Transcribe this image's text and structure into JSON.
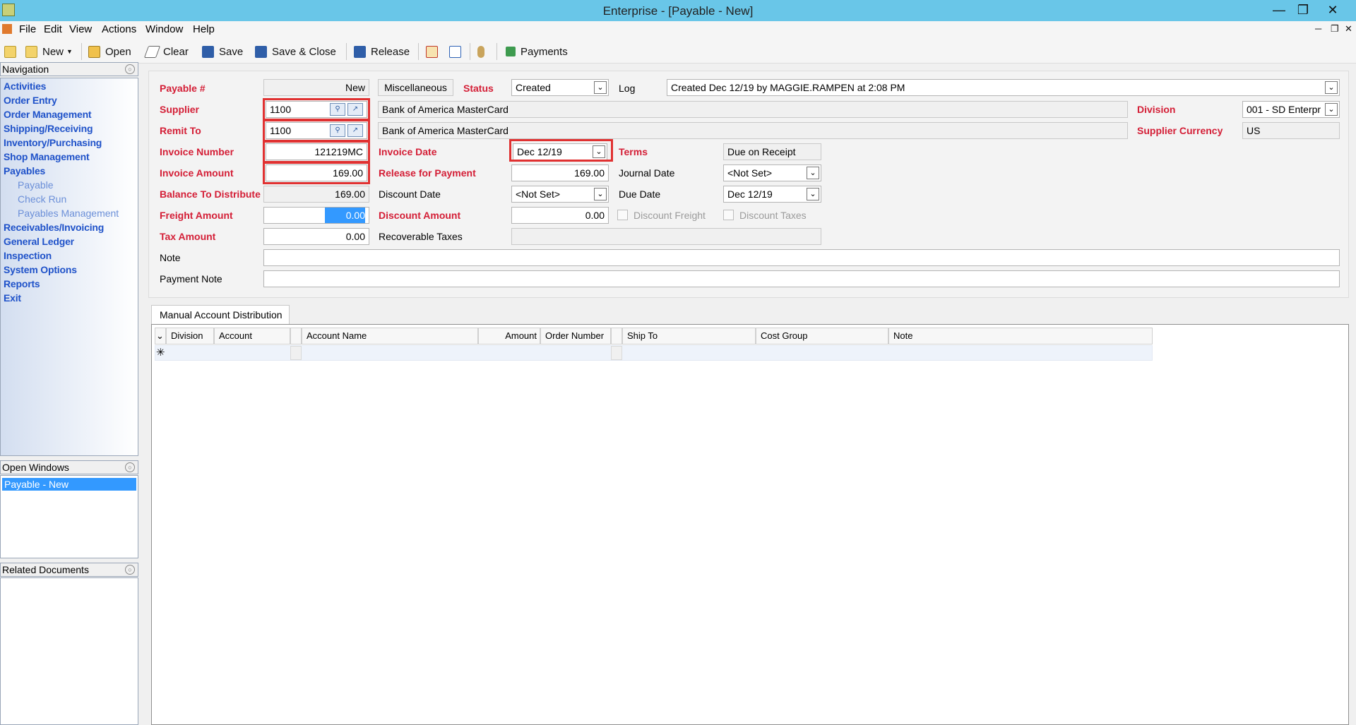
{
  "window": {
    "title": "Enterprise - [Payable - New]"
  },
  "menu": [
    "File",
    "Edit",
    "View",
    "Actions",
    "Window",
    "Help"
  ],
  "toolbar": {
    "new_label": "New",
    "open_label": "Open",
    "clear_label": "Clear",
    "save_label": "Save",
    "save_close_label": "Save & Close",
    "release_label": "Release",
    "payments_label": "Payments"
  },
  "navigation": {
    "header": "Navigation",
    "items": [
      "Activities",
      "Order Entry",
      "Order Management",
      "Shipping/Receiving",
      "Inventory/Purchasing",
      "Shop Management",
      "Payables"
    ],
    "sub_items": [
      "Payable",
      "Check Run",
      "Payables Management"
    ],
    "items_after": [
      "Receivables/Invoicing",
      "General Ledger",
      "Inspection",
      "System Options",
      "Reports",
      "Exit"
    ]
  },
  "open_windows": {
    "header": "Open Windows",
    "items": [
      "Payable - New"
    ]
  },
  "related_documents": {
    "header": "Related Documents"
  },
  "form": {
    "payable_no_label": "Payable #",
    "payable_no_value": "New",
    "misc_button": "Miscellaneous",
    "status_label": "Status",
    "status_value": "Created",
    "log_label": "Log",
    "log_value": "Created Dec 12/19 by MAGGIE.RAMPEN at 2:08 PM",
    "supplier_label": "Supplier",
    "supplier_value": "1100",
    "supplier_name": "Bank of America MasterCard",
    "division_label": "Division",
    "division_value": "001 - SD Enterpr",
    "remit_to_label": "Remit To",
    "remit_to_value": "1100",
    "remit_to_name": "Bank of America MasterCard",
    "supplier_currency_label": "Supplier Currency",
    "supplier_currency_value": "US",
    "invoice_number_label": "Invoice Number",
    "invoice_number_value": "121219MC",
    "invoice_date_label": "Invoice Date",
    "invoice_date_value": "Dec 12/19",
    "terms_label": "Terms",
    "terms_value": "Due on Receipt",
    "invoice_amount_label": "Invoice Amount",
    "invoice_amount_value": "169.00",
    "release_for_payment_label": "Release for Payment",
    "release_for_payment_value": "169.00",
    "journal_date_label": "Journal Date",
    "journal_date_value": "<Not Set>",
    "balance_label": "Balance To Distribute",
    "balance_value": "169.00",
    "discount_date_label": "Discount Date",
    "discount_date_value": "<Not Set>",
    "due_date_label": "Due Date",
    "due_date_value": "Dec 12/19",
    "freight_amount_label": "Freight Amount",
    "freight_amount_value": "0.00",
    "discount_amount_label": "Discount Amount",
    "discount_amount_value": "0.00",
    "discount_freight_label": "Discount Freight",
    "discount_taxes_label": "Discount Taxes",
    "tax_amount_label": "Tax Amount",
    "tax_amount_value": "0.00",
    "recoverable_taxes_label": "Recoverable Taxes",
    "recoverable_taxes_value": "",
    "note_label": "Note",
    "note_value": "",
    "payment_note_label": "Payment Note",
    "payment_note_value": ""
  },
  "tab": {
    "label": "Manual Account Distribution"
  },
  "grid": {
    "columns": [
      "Division",
      "Account",
      "Account Name",
      "Amount",
      "Order Number",
      "Ship To",
      "Cost Group",
      "Note"
    ],
    "new_row_marker": "✳"
  },
  "colors": {
    "titlebar": "#69c6e8",
    "required_label": "#d41e36",
    "nav_link": "#1f52c9",
    "highlight_box": "#e03131",
    "selection": "#3399ff"
  }
}
